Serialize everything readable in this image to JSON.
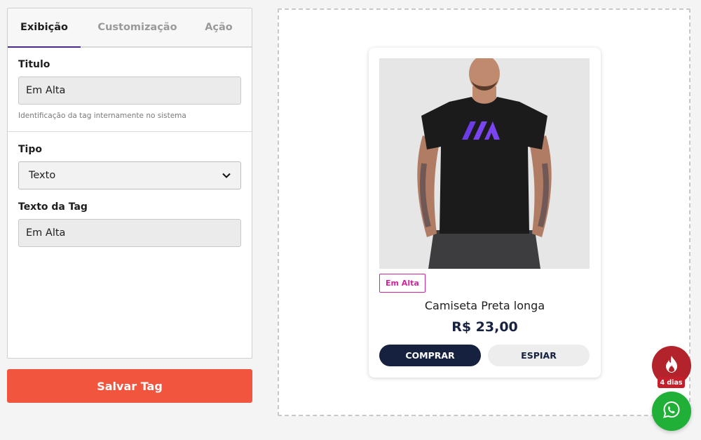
{
  "tabs": [
    "Exibição",
    "Customização",
    "Ação"
  ],
  "form": {
    "title_label": "Titulo",
    "title_value": "Em Alta",
    "title_help": "Identificação da tag internamente no sistema",
    "type_label": "Tipo",
    "type_value": "Texto",
    "tag_text_label": "Texto da Tag",
    "tag_text_value": "Em Alta",
    "save_label": "Salvar Tag"
  },
  "preview": {
    "tag_text": "Em Alta",
    "product_name": "Camiseta Preta longa",
    "price": "R$ 23,00",
    "buy_label": "COMPRAR",
    "spy_label": "ESPIAR"
  },
  "widgets": {
    "fire_badge": "4 dias"
  },
  "colors": {
    "accent_tab": "#4a2a8c",
    "save_button": "#f2553d",
    "tag": "#d0249b",
    "buy_button": "#15213e",
    "fire": "#b3232b",
    "whatsapp": "#20b038"
  },
  "icons": [
    "chevron-down-icon",
    "fire-icon",
    "whatsapp-icon"
  ]
}
